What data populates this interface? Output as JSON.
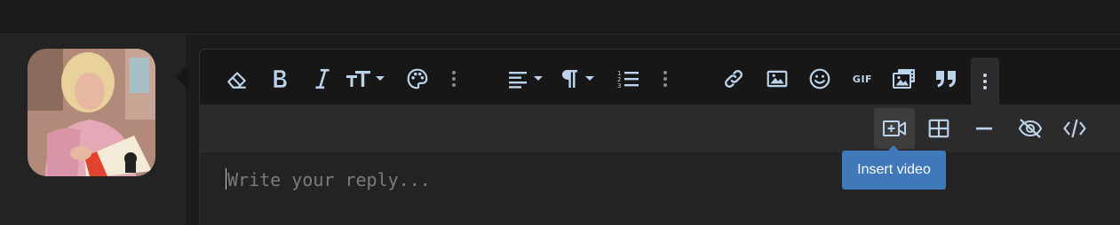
{
  "reply": {
    "placeholder": "Write your reply..."
  },
  "toolbar": {
    "row1": [
      {
        "name": "clear-formatting",
        "icon": "eraser-icon"
      },
      {
        "name": "bold",
        "icon": "bold-icon"
      },
      {
        "name": "italic",
        "icon": "italic-icon"
      },
      {
        "name": "font-size",
        "icon": "text-size-icon",
        "dropdown": true
      },
      {
        "name": "text-color",
        "icon": "palette-icon"
      },
      {
        "name": "more-text",
        "icon": "vertical-ellipsis-icon"
      },
      {
        "name": "align",
        "icon": "align-left-icon",
        "dropdown": true
      },
      {
        "name": "paragraph-format",
        "icon": "paragraph-icon",
        "dropdown": true
      },
      {
        "name": "ordered-list",
        "icon": "numbered-list-icon"
      },
      {
        "name": "more-paragraph",
        "icon": "vertical-ellipsis-icon"
      },
      {
        "name": "insert-link",
        "icon": "link-icon"
      },
      {
        "name": "insert-image",
        "icon": "image-icon"
      },
      {
        "name": "smilies",
        "icon": "smiley-icon"
      },
      {
        "name": "insert-gif",
        "icon": "gif-icon",
        "label": "GIF"
      },
      {
        "name": "media",
        "icon": "media-icon"
      },
      {
        "name": "quote",
        "icon": "quote-icon"
      },
      {
        "name": "more-rich",
        "icon": "vertical-ellipsis-icon",
        "active": true
      }
    ],
    "row2": [
      {
        "name": "insert-video",
        "icon": "video-plus-icon",
        "hovered": true
      },
      {
        "name": "insert-table",
        "icon": "table-icon"
      },
      {
        "name": "horizontal-line",
        "icon": "minus-icon"
      },
      {
        "name": "spoiler",
        "icon": "eye-slash-icon"
      },
      {
        "name": "code",
        "icon": "code-icon"
      }
    ],
    "gif_label": "GIF"
  },
  "tooltip": {
    "text": "Insert video"
  },
  "colors": {
    "icon": "#bcd3ec",
    "tooltip_bg": "#3f79b9",
    "toolbar_bg": "#171717",
    "toolbar2_bg": "#2b2b2b",
    "editor_bg": "#232323"
  }
}
